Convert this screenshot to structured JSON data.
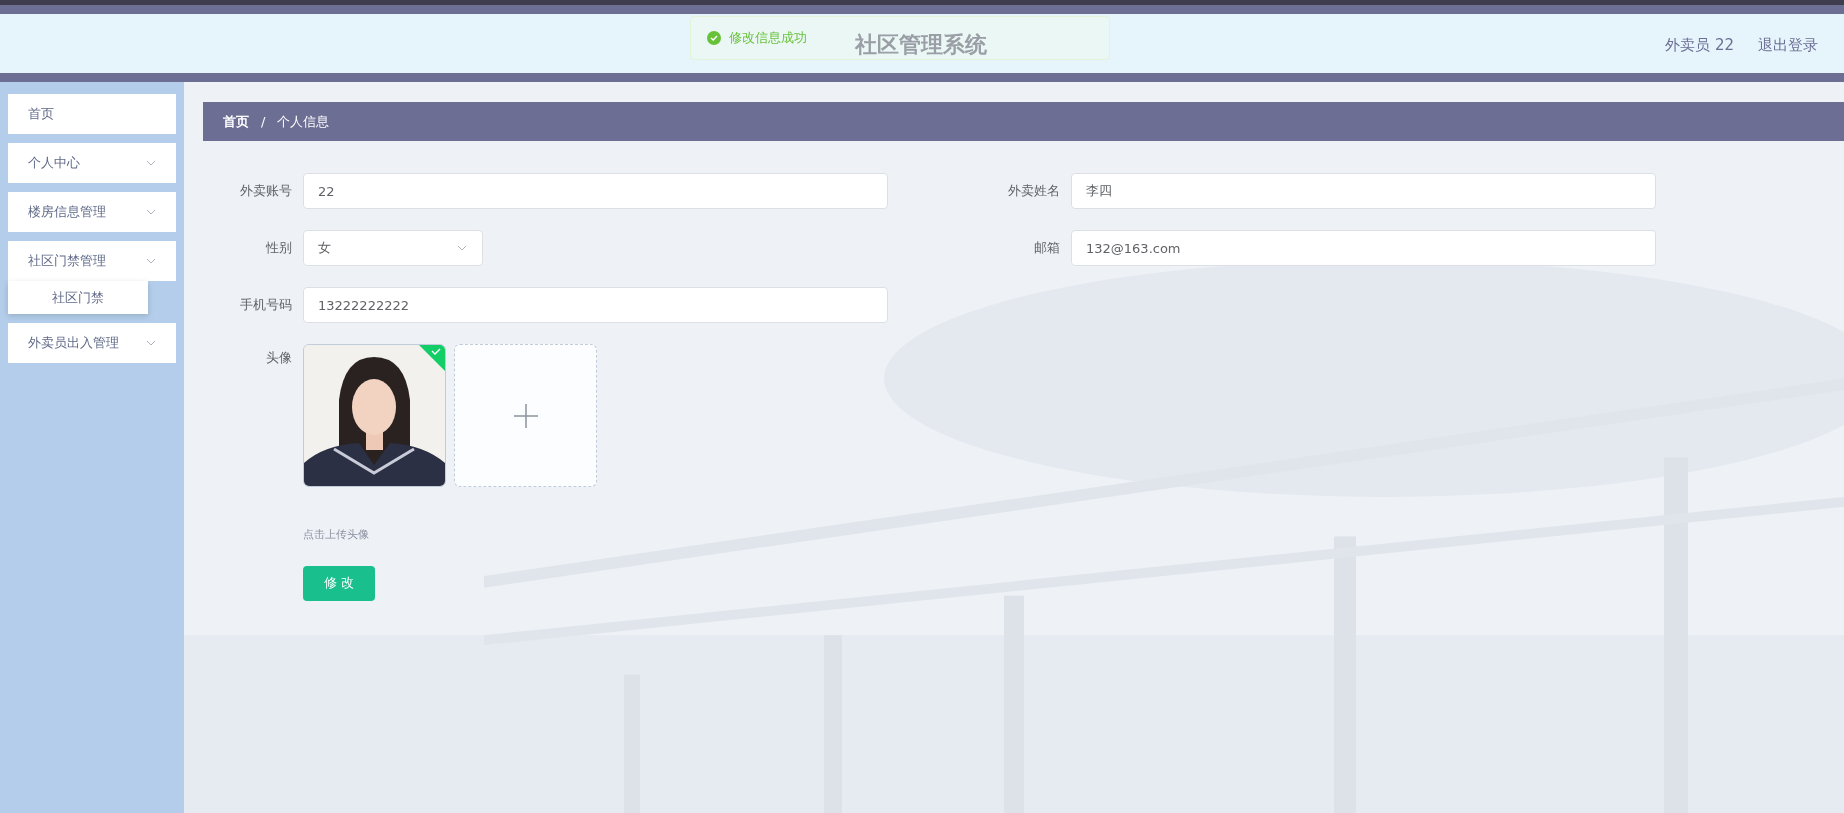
{
  "header": {
    "title": "社区管理系统",
    "toast": {
      "kind": "success",
      "message": "修改信息成功"
    },
    "user": "外卖员 22",
    "logout": "退出登录"
  },
  "sidebar": {
    "items": [
      {
        "label": "首页",
        "has_children": false,
        "expanded": false
      },
      {
        "label": "个人中心",
        "has_children": true,
        "expanded": false
      },
      {
        "label": "楼房信息管理",
        "has_children": true,
        "expanded": false
      },
      {
        "label": "社区门禁管理",
        "has_children": true,
        "expanded": true,
        "children": [
          {
            "label": "社区门禁"
          }
        ]
      },
      {
        "label": "外卖员出入管理",
        "has_children": true,
        "expanded": false
      }
    ]
  },
  "breadcrumb_separator": "/",
  "breadcrumb": [
    {
      "label": "首页",
      "current": false
    },
    {
      "label": "个人信息",
      "current": true
    }
  ],
  "form": {
    "left_fields": [
      {
        "label": "外卖账号",
        "kind": "text",
        "value": "22"
      },
      {
        "label": "性别",
        "kind": "select",
        "value": "女"
      },
      {
        "label": "手机号码",
        "kind": "text",
        "value": "13222222222"
      }
    ],
    "right_fields": [
      {
        "label": "外卖姓名",
        "kind": "text",
        "value": "李四"
      },
      {
        "label": "邮箱",
        "kind": "text",
        "value": "132@163.com"
      }
    ],
    "avatar": {
      "label": "头像",
      "uploaded": true,
      "hint": "点击上传头像"
    },
    "submit": "修 改"
  }
}
